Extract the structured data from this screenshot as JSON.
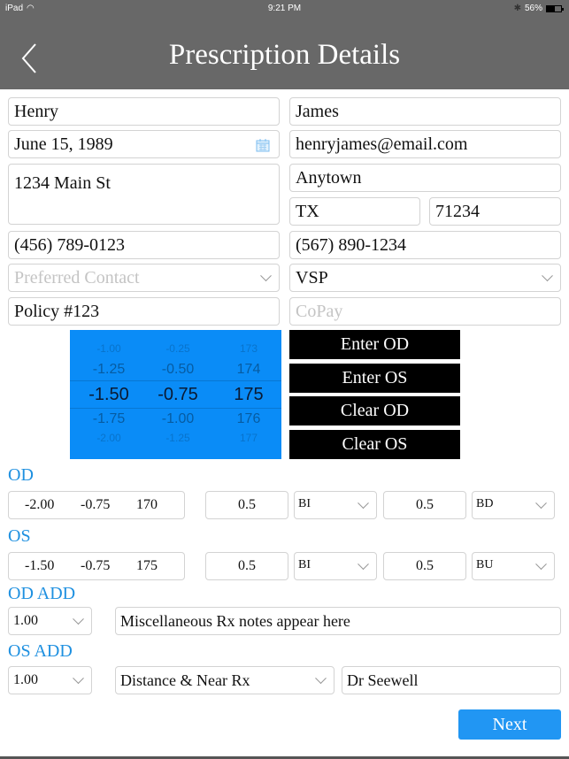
{
  "status_bar": {
    "device": "iPad",
    "time": "9:21 PM",
    "battery": "56%",
    "battery_level": 0.56
  },
  "header": {
    "title": "Prescription Details",
    "back_icon": "chevron-left-icon"
  },
  "patient": {
    "first_name": "Henry",
    "last_name": "James",
    "dob": "June 15, 1989",
    "email": "henryjames@email.com",
    "address": "1234 Main St",
    "city": "Anytown",
    "state": "TX",
    "zip": "71234",
    "phone1": "(456) 789-0123",
    "phone2": "(567) 890-1234",
    "preferred_contact_placeholder": "Preferred Contact",
    "insurance": "VSP",
    "policy": "Policy #123",
    "copay_placeholder": "CoPay"
  },
  "picker": {
    "columns": [
      {
        "values": [
          "-1.00",
          "-1.25",
          "-1.50",
          "-1.75",
          "-2.00"
        ]
      },
      {
        "values": [
          "-0.25",
          "-0.50",
          "-0.75",
          "-1.00",
          "-1.25"
        ]
      },
      {
        "values": [
          "173",
          "174",
          "175",
          "176",
          "177"
        ]
      }
    ],
    "selected_index": 2
  },
  "actions": {
    "enter_od": "Enter OD",
    "enter_os": "Enter OS",
    "clear_od": "Clear OD",
    "clear_os": "Clear OS"
  },
  "od": {
    "label": "OD",
    "sphere": "-2.00",
    "cylinder": "-0.75",
    "axis": "170",
    "prism1": "0.5",
    "base1": "BI",
    "prism2": "0.5",
    "base2": "BD"
  },
  "os": {
    "label": "OS",
    "sphere": "-1.50",
    "cylinder": "-0.75",
    "axis": "175",
    "prism1": "0.5",
    "base1": "BI",
    "prism2": "0.5",
    "base2": "BU"
  },
  "od_add": {
    "label": "OD ADD",
    "value": "1.00",
    "notes": "Miscellaneous Rx notes appear here"
  },
  "os_add": {
    "label": "OS ADD",
    "value": "1.00",
    "rx_type": "Distance & Near Rx",
    "doctor": "Dr Seewell"
  },
  "next_label": "Next"
}
